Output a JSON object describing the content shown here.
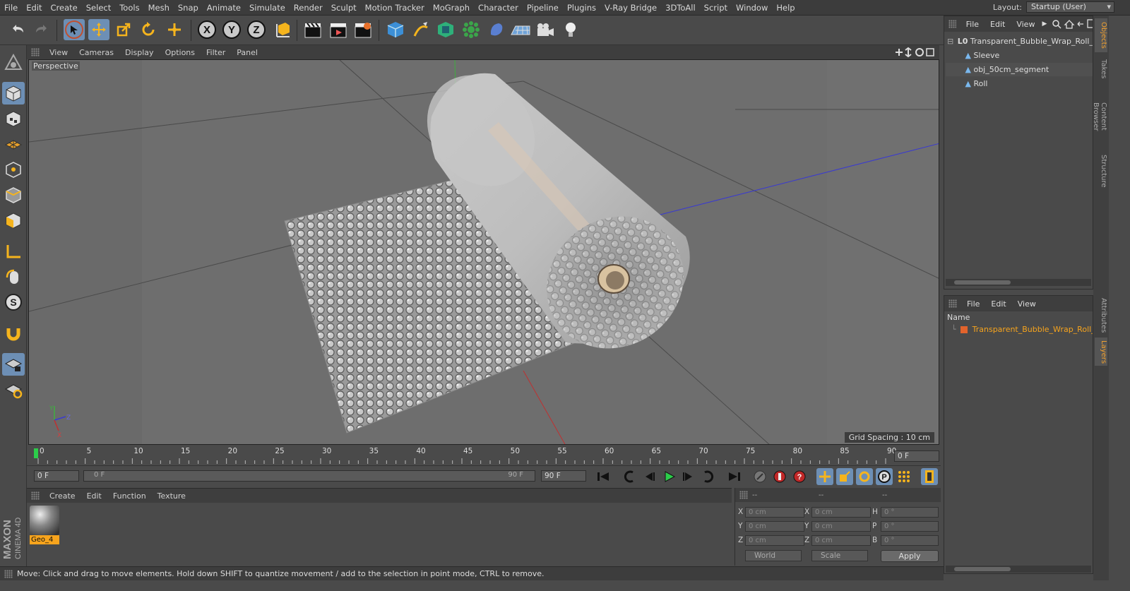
{
  "menubar": {
    "items": [
      "File",
      "Edit",
      "Create",
      "Select",
      "Tools",
      "Mesh",
      "Snap",
      "Animate",
      "Simulate",
      "Render",
      "Sculpt",
      "Motion Tracker",
      "MoGraph",
      "Character",
      "Pipeline",
      "Plugins",
      "V-Ray Bridge",
      "3DToAll",
      "Script",
      "Window",
      "Help"
    ],
    "layout_label": "Layout:",
    "layout_value": "Startup (User)"
  },
  "toolbar": {
    "axis_x": "X",
    "axis_y": "Y",
    "axis_z": "Z"
  },
  "viewport": {
    "menu": [
      "View",
      "Cameras",
      "Display",
      "Options",
      "Filter",
      "Panel"
    ],
    "label": "Perspective",
    "grid_spacing": "Grid Spacing : 10 cm"
  },
  "timeline": {
    "ticks": [
      "0",
      "5",
      "10",
      "15",
      "20",
      "25",
      "30",
      "35",
      "40",
      "45",
      "50",
      "55",
      "60",
      "65",
      "70",
      "75",
      "80",
      "85",
      "90"
    ],
    "current_frame": "0 F"
  },
  "transport": {
    "start_field": "0 F",
    "range_start": "0 F",
    "range_end": "90 F",
    "end_field": "90 F"
  },
  "material": {
    "menu": [
      "Create",
      "Edit",
      "Function",
      "Texture"
    ],
    "swatch_label": "Geo_4"
  },
  "coords": {
    "header": [
      "--",
      "--",
      "--"
    ],
    "rows": [
      {
        "a": "X",
        "av": "0 cm",
        "b": "X",
        "bv": "0 cm",
        "c": "H",
        "cv": "0 °"
      },
      {
        "a": "Y",
        "av": "0 cm",
        "b": "Y",
        "bv": "0 cm",
        "c": "P",
        "cv": "0 °"
      },
      {
        "a": "Z",
        "av": "0 cm",
        "b": "Z",
        "bv": "0 cm",
        "c": "B",
        "cv": "0 °"
      }
    ],
    "world": "World",
    "scale": "Scale",
    "apply": "Apply"
  },
  "status": "Move: Click and drag to move elements. Hold down SHIFT to quantize movement / add to the selection in point mode, CTRL to remove.",
  "objects": {
    "menu": [
      "File",
      "Edit",
      "View"
    ],
    "items": [
      "Transparent_Bubble_Wrap_Roll_Pa",
      "Sleeve",
      "obj_50cm_segment",
      "Roll"
    ]
  },
  "attributes": {
    "menu": [
      "File",
      "Edit",
      "View"
    ],
    "name_header": "Name",
    "layer_item": "Transparent_Bubble_Wrap_Roll_P"
  },
  "side_tabs": [
    "Objects",
    "Takes",
    "Content Browser",
    "Structure",
    "Attributes",
    "Layers"
  ],
  "logo": {
    "line1": "MAXON",
    "line2": "CINEMA 4D"
  },
  "colors": {
    "accent": "#6d8fb5",
    "orange": "#f7a41d"
  }
}
